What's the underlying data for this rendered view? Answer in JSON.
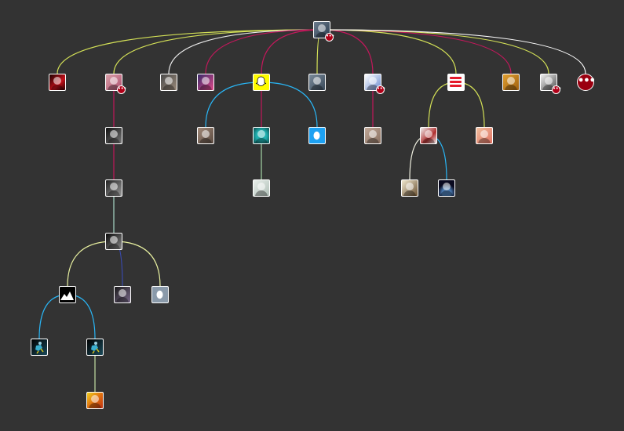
{
  "colors": {
    "background": "#333333",
    "node_border": "#ffffff",
    "badge": "#b00018"
  },
  "root": "n-root",
  "nodes": [
    {
      "id": "n-root",
      "name": "root-avatar",
      "bg": "linear-gradient(135deg,#6b7b8c,#2c3e50)",
      "badge": true
    },
    {
      "id": "n1",
      "name": "avatar-red-figure",
      "bg": "linear-gradient(135deg,#1a0000,#c4101a 60%,#2a0000)"
    },
    {
      "id": "n2",
      "name": "avatar-smiling-man",
      "bg": "linear-gradient(135deg,#d8a0a8,#b05070)",
      "badge": true
    },
    {
      "id": "n3",
      "name": "avatar-bearded-man",
      "bg": "linear-gradient(135deg,#4a4a4a,#9a8a7a)"
    },
    {
      "id": "n4",
      "name": "avatar-couple-selfie",
      "bg": "linear-gradient(135deg,#3a2a6a,#e04a8a)"
    },
    {
      "id": "n5",
      "name": "avatar-snapchat-ghost",
      "bg": "#fffc00",
      "icon": "ghost"
    },
    {
      "id": "n6",
      "name": "avatar-man-glasses",
      "bg": "linear-gradient(135deg,#7a8a9a,#3a4a5a)"
    },
    {
      "id": "n7",
      "name": "avatar-cartoon-boy",
      "bg": "linear-gradient(135deg,#ffffff,#6a8ad0)",
      "badge": true
    },
    {
      "id": "n8",
      "name": "avatar-red-stripes-logo",
      "bg": "#ffffff",
      "icon": "stripes"
    },
    {
      "id": "n9",
      "name": "avatar-golden-statue",
      "bg": "linear-gradient(135deg,#e0a030,#a06010)"
    },
    {
      "id": "n10",
      "name": "avatar-bw-photo",
      "bg": "linear-gradient(135deg,#eeeeee,#555555)",
      "badge": true
    },
    {
      "id": "n11",
      "name": "avatar-bw-portrait-a",
      "bg": "linear-gradient(135deg,#111111,#777777)"
    },
    {
      "id": "n12",
      "name": "avatar-bw-portrait-b",
      "bg": "linear-gradient(135deg,#222222,#999999)"
    },
    {
      "id": "n13",
      "name": "avatar-bw-portrait-c",
      "bg": "linear-gradient(135deg,#0a0a0a,#888888)"
    },
    {
      "id": "n14",
      "name": "avatar-mountain-icon",
      "bg": "#000000",
      "icon": "mountain"
    },
    {
      "id": "n15",
      "name": "avatar-dim-photo",
      "bg": "linear-gradient(135deg,#1a1a1a,#7a6a8a)"
    },
    {
      "id": "n16",
      "name": "avatar-egg-default-grey",
      "bg": "#8a9aaa",
      "icon": "egg"
    },
    {
      "id": "n17",
      "name": "avatar-blue-figure-a",
      "bg": "linear-gradient(135deg,#000000,#1a4a5a)",
      "icon": "figure"
    },
    {
      "id": "n18",
      "name": "avatar-blue-figure-b",
      "bg": "linear-gradient(135deg,#000000,#1a4a5a)",
      "icon": "figure"
    },
    {
      "id": "n19",
      "name": "avatar-yellow-pattern",
      "bg": "linear-gradient(135deg,#f0d020,#e07010 50%,#c03010)"
    },
    {
      "id": "n20",
      "name": "avatar-woman-photo",
      "bg": "linear-gradient(135deg,#a08878,#5a4a40)"
    },
    {
      "id": "n21",
      "name": "avatar-teal-globe",
      "bg": "radial-gradient(circle,#20b0b0 45%,#0a4a4a)"
    },
    {
      "id": "n22",
      "name": "avatar-egg-default-blue",
      "bg": "#1da1f2",
      "icon": "egg"
    },
    {
      "id": "n23",
      "name": "avatar-man-photo",
      "bg": "linear-gradient(135deg,#c0a898,#8a7060)"
    },
    {
      "id": "n24",
      "name": "avatar-shrimp-illustration",
      "bg": "linear-gradient(135deg,#e8eeea,#b0c0b8)"
    },
    {
      "id": "n25",
      "name": "avatar-man-tie",
      "bg": "linear-gradient(135deg,#f0f0f0,#b03030 60%,#f0f0f0)"
    },
    {
      "id": "n26",
      "name": "avatar-woman-pink",
      "bg": "linear-gradient(135deg,#f0c0a0,#e07060)"
    },
    {
      "id": "n27",
      "name": "avatar-man-hat",
      "bg": "linear-gradient(135deg,#f0e8d0,#6a5030)"
    },
    {
      "id": "n28",
      "name": "avatar-earth-space",
      "bg": "radial-gradient(circle at 50% 80%,#4a7ab0 30%,#0a0a20 60%)"
    }
  ],
  "more_node": {
    "id": "n-more",
    "name": "more-options-node",
    "label": "•••"
  },
  "edges": [
    {
      "from": "n-root",
      "to": "n1",
      "color": "#d4e157"
    },
    {
      "from": "n-root",
      "to": "n2",
      "color": "#d4e157"
    },
    {
      "from": "n-root",
      "to": "n3",
      "color": "#e8e8e8"
    },
    {
      "from": "n-root",
      "to": "n4",
      "color": "#c2185b"
    },
    {
      "from": "n-root",
      "to": "n5",
      "color": "#c2185b"
    },
    {
      "from": "n-root",
      "to": "n6",
      "color": "#d4e157"
    },
    {
      "from": "n-root",
      "to": "n7",
      "color": "#c2185b"
    },
    {
      "from": "n-root",
      "to": "n8",
      "color": "#d4e157"
    },
    {
      "from": "n-root",
      "to": "n9",
      "color": "#c2185b"
    },
    {
      "from": "n-root",
      "to": "n10",
      "color": "#d4e157"
    },
    {
      "from": "n-root",
      "to": "n-more",
      "color": "#ffffff"
    },
    {
      "from": "n2",
      "to": "n11",
      "color": "#c2185b"
    },
    {
      "from": "n11",
      "to": "n12",
      "color": "#c2185b"
    },
    {
      "from": "n12",
      "to": "n13",
      "color": "#a8d8c8"
    },
    {
      "from": "n13",
      "to": "n14",
      "color": "#e8f0a0"
    },
    {
      "from": "n13",
      "to": "n15",
      "color": "#3949ab"
    },
    {
      "from": "n13",
      "to": "n16",
      "color": "#e8f0a0"
    },
    {
      "from": "n14",
      "to": "n17",
      "color": "#29b6f6"
    },
    {
      "from": "n14",
      "to": "n18",
      "color": "#29b6f6"
    },
    {
      "from": "n18",
      "to": "n19",
      "color": "#c5e1a5"
    },
    {
      "from": "n5",
      "to": "n20",
      "color": "#29b6f6"
    },
    {
      "from": "n5",
      "to": "n21",
      "color": "#c2185b"
    },
    {
      "from": "n5",
      "to": "n22",
      "color": "#29b6f6"
    },
    {
      "from": "n21",
      "to": "n24",
      "color": "#a5d6a7"
    },
    {
      "from": "n7",
      "to": "n23",
      "color": "#c2185b"
    },
    {
      "from": "n8",
      "to": "n25",
      "color": "#d4e157"
    },
    {
      "from": "n8",
      "to": "n26",
      "color": "#d4e157"
    },
    {
      "from": "n25",
      "to": "n27",
      "color": "#f0f0e0"
    },
    {
      "from": "n25",
      "to": "n28",
      "color": "#29b6f6"
    }
  ]
}
